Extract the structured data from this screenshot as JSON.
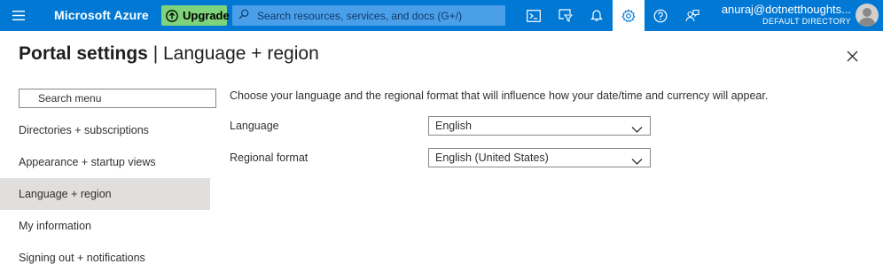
{
  "topbar": {
    "brand": "Microsoft Azure",
    "upgrade_label": "Upgrade",
    "search_placeholder": "Search resources, services, and docs (G+/)",
    "icons": [
      "hamburger-icon",
      "cloud-shell-icon",
      "directory-filter-icon",
      "notifications-icon",
      "settings-icon",
      "help-icon",
      "feedback-icon"
    ],
    "account_name": "anuraj@dotnetthoughts...",
    "account_directory": "DEFAULT DIRECTORY"
  },
  "page": {
    "title_main": "Portal settings",
    "title_separator": " | ",
    "title_section": "Language + region"
  },
  "menu": {
    "search_placeholder": "Search menu",
    "items": [
      {
        "label": "Directories + subscriptions"
      },
      {
        "label": "Appearance + startup views"
      },
      {
        "label": "Language + region",
        "selected": true
      },
      {
        "label": "My information"
      },
      {
        "label": "Signing out + notifications"
      }
    ]
  },
  "content": {
    "description": "Choose your language and the regional format that will influence how your date/time and currency will appear.",
    "language_label": "Language",
    "language_value": "English",
    "region_label": "Regional format",
    "region_value": "English (United States)"
  },
  "colors": {
    "topbar": "#0078d4",
    "upgrade": "#7fd47b",
    "search_box": "#4a9fe8",
    "selected_menu": "#e1dfdd"
  }
}
